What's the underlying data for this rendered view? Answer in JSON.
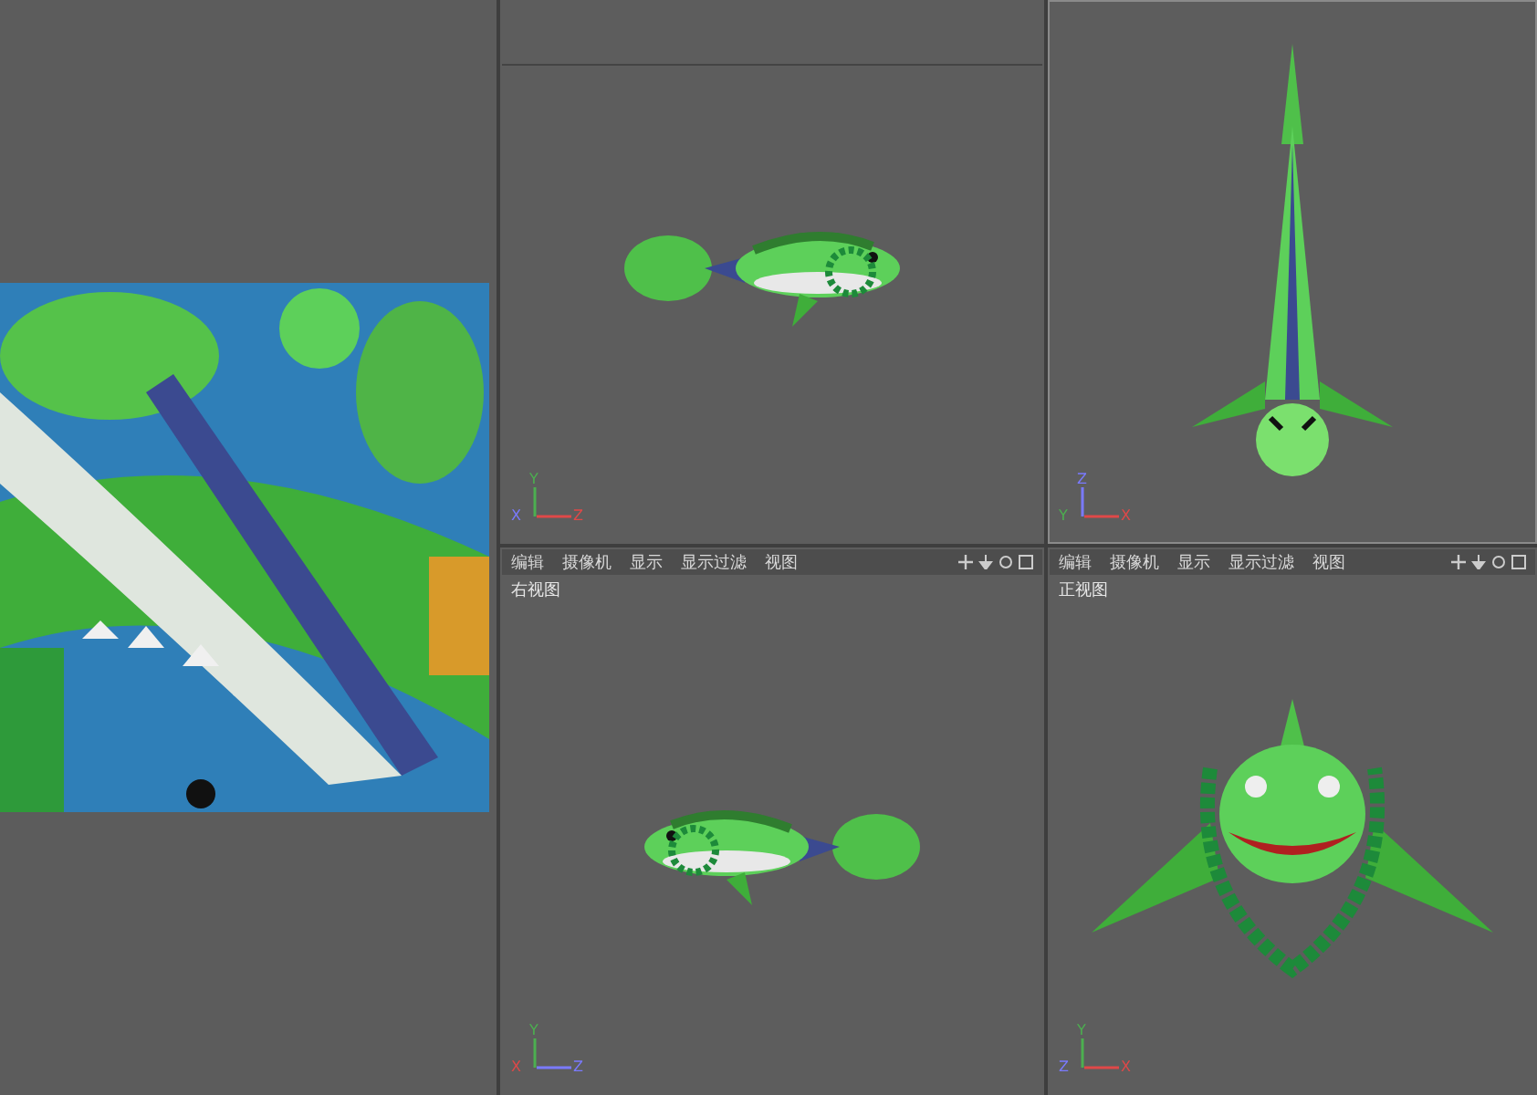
{
  "texture_panel": {
    "kind": "uv_texture"
  },
  "viewports": [
    {
      "kind": "side_right",
      "axes": [
        {
          "kind": "up",
          "label": "Y",
          "color": "#4caf50"
        },
        {
          "kind": "origin",
          "label": "X",
          "color": "#7a7aff"
        },
        {
          "kind": "side",
          "label": "Z",
          "color": "#e04848"
        }
      ]
    },
    {
      "kind": "top",
      "axes": [
        {
          "kind": "up",
          "label": "Z",
          "color": "#7a7aff"
        },
        {
          "kind": "origin",
          "label": "Y",
          "color": "#4caf50"
        },
        {
          "kind": "side",
          "label": "X",
          "color": "#e04848"
        }
      ]
    },
    {
      "kind": "side_left",
      "menu": [
        "编辑",
        "摄像机",
        "显示",
        "显示过滤",
        "视图"
      ],
      "label": "右视图",
      "axes": [
        {
          "kind": "up",
          "label": "Y",
          "color": "#4caf50"
        },
        {
          "kind": "origin",
          "label": "X",
          "color": "#e04848"
        },
        {
          "kind": "side",
          "label": "Z",
          "color": "#7a7aff"
        }
      ]
    },
    {
      "kind": "front",
      "menu": [
        "编辑",
        "摄像机",
        "显示",
        "显示过滤",
        "视图"
      ],
      "label": "正视图",
      "axes": [
        {
          "kind": "up",
          "label": "Y",
          "color": "#4caf50"
        },
        {
          "kind": "origin",
          "label": "Z",
          "color": "#7a7aff"
        },
        {
          "kind": "side",
          "label": "X",
          "color": "#e04848"
        }
      ]
    }
  ]
}
